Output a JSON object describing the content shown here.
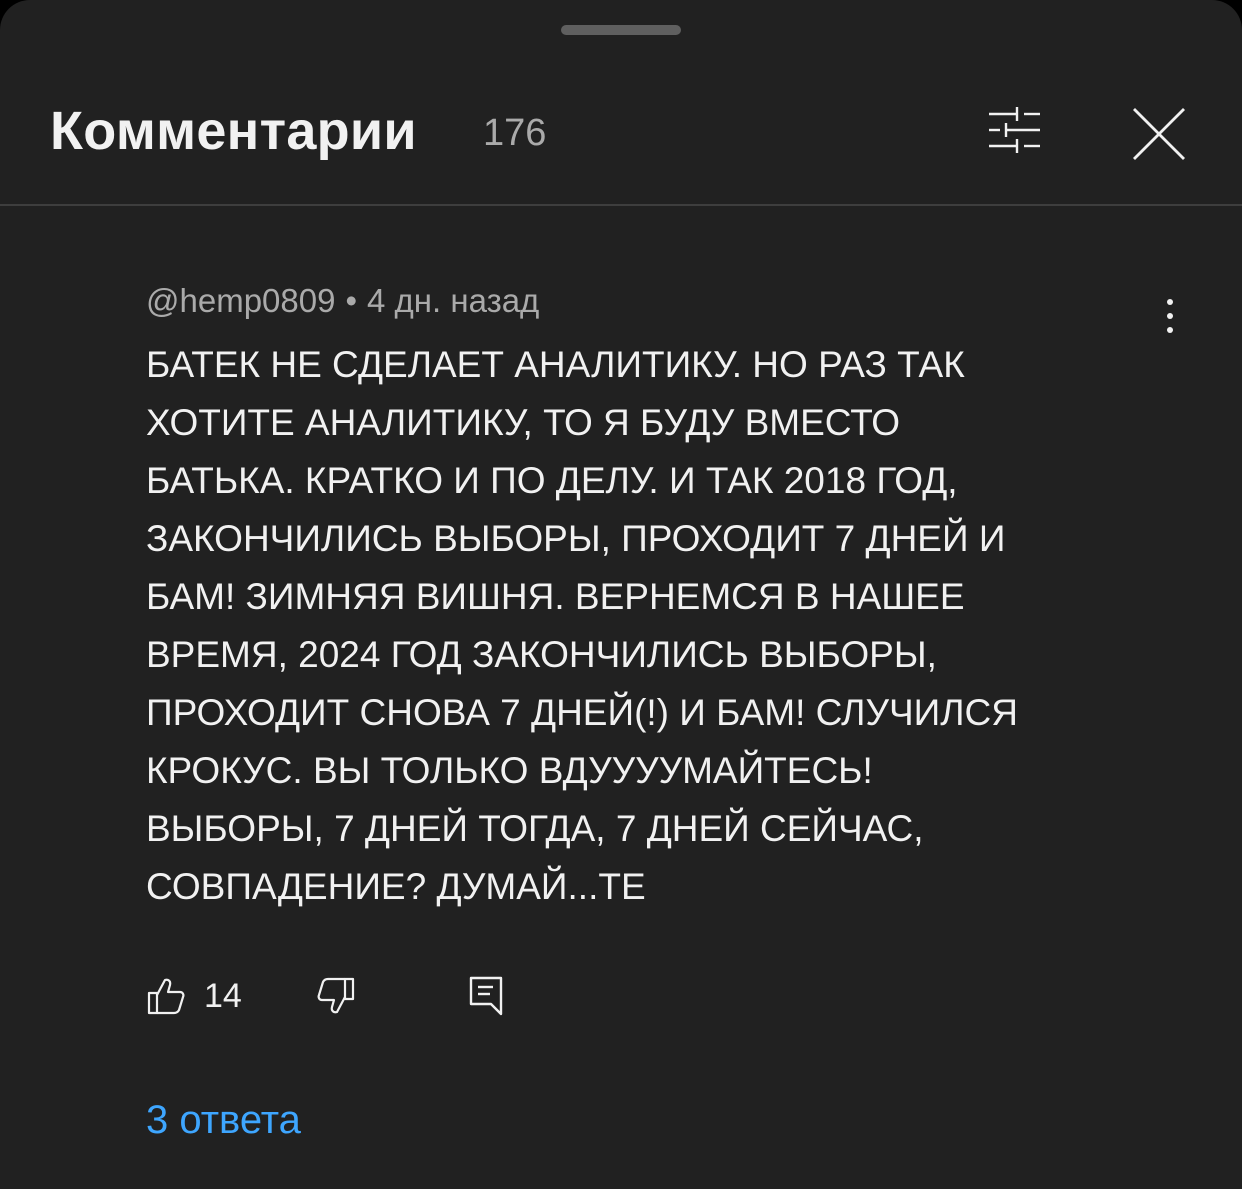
{
  "header": {
    "title": "Комментарии",
    "count": "176",
    "filter_icon": "sliders-icon",
    "close_icon": "close-icon"
  },
  "comment": {
    "author": "@hemp0809",
    "separator": "•",
    "time": "4 дн. назад",
    "text_lines": [
      "БАТЕК НЕ СДЕЛАЕТ АНАЛИТИКУ. НО РАЗ ТАК",
      "ХОТИТЕ АНАЛИТИКУ, ТО Я БУДУ ВМЕСТО",
      "БАТЬКА. КРАТКО И ПО ДЕЛУ. И ТАК 2018 ГОД,",
      "ЗАКОНЧИЛИСЬ ВЫБОРЫ, ПРОХОДИТ 7 ДНЕЙ И",
      "БАМ! ЗИМНЯЯ ВИШНЯ. ВЕРНЕМСЯ В НАШЕЕ",
      "ВРЕМЯ, 2024 ГОД ЗАКОНЧИЛИСЬ ВЫБОРЫ,",
      "ПРОХОДИТ СНОВА 7 ДНЕЙ(!) И БАМ! СЛУЧИЛСЯ",
      "КРОКУС. ВЫ ТОЛЬКО ВДУУУУМАЙТЕСЬ!",
      "ВЫБОРЫ, 7 ДНЕЙ ТОГДА, 7 ДНЕЙ СЕЙЧАС,",
      "СОВПАДЕНИЕ? ДУМАЙ...ТЕ"
    ],
    "likes": "14",
    "replies_label": "3 ответа"
  },
  "colors": {
    "background": "#212121",
    "text": "#f1f1f1",
    "secondary_text": "#aaaaaa",
    "link": "#3ea6ff",
    "divider": "#3e3e3e"
  }
}
